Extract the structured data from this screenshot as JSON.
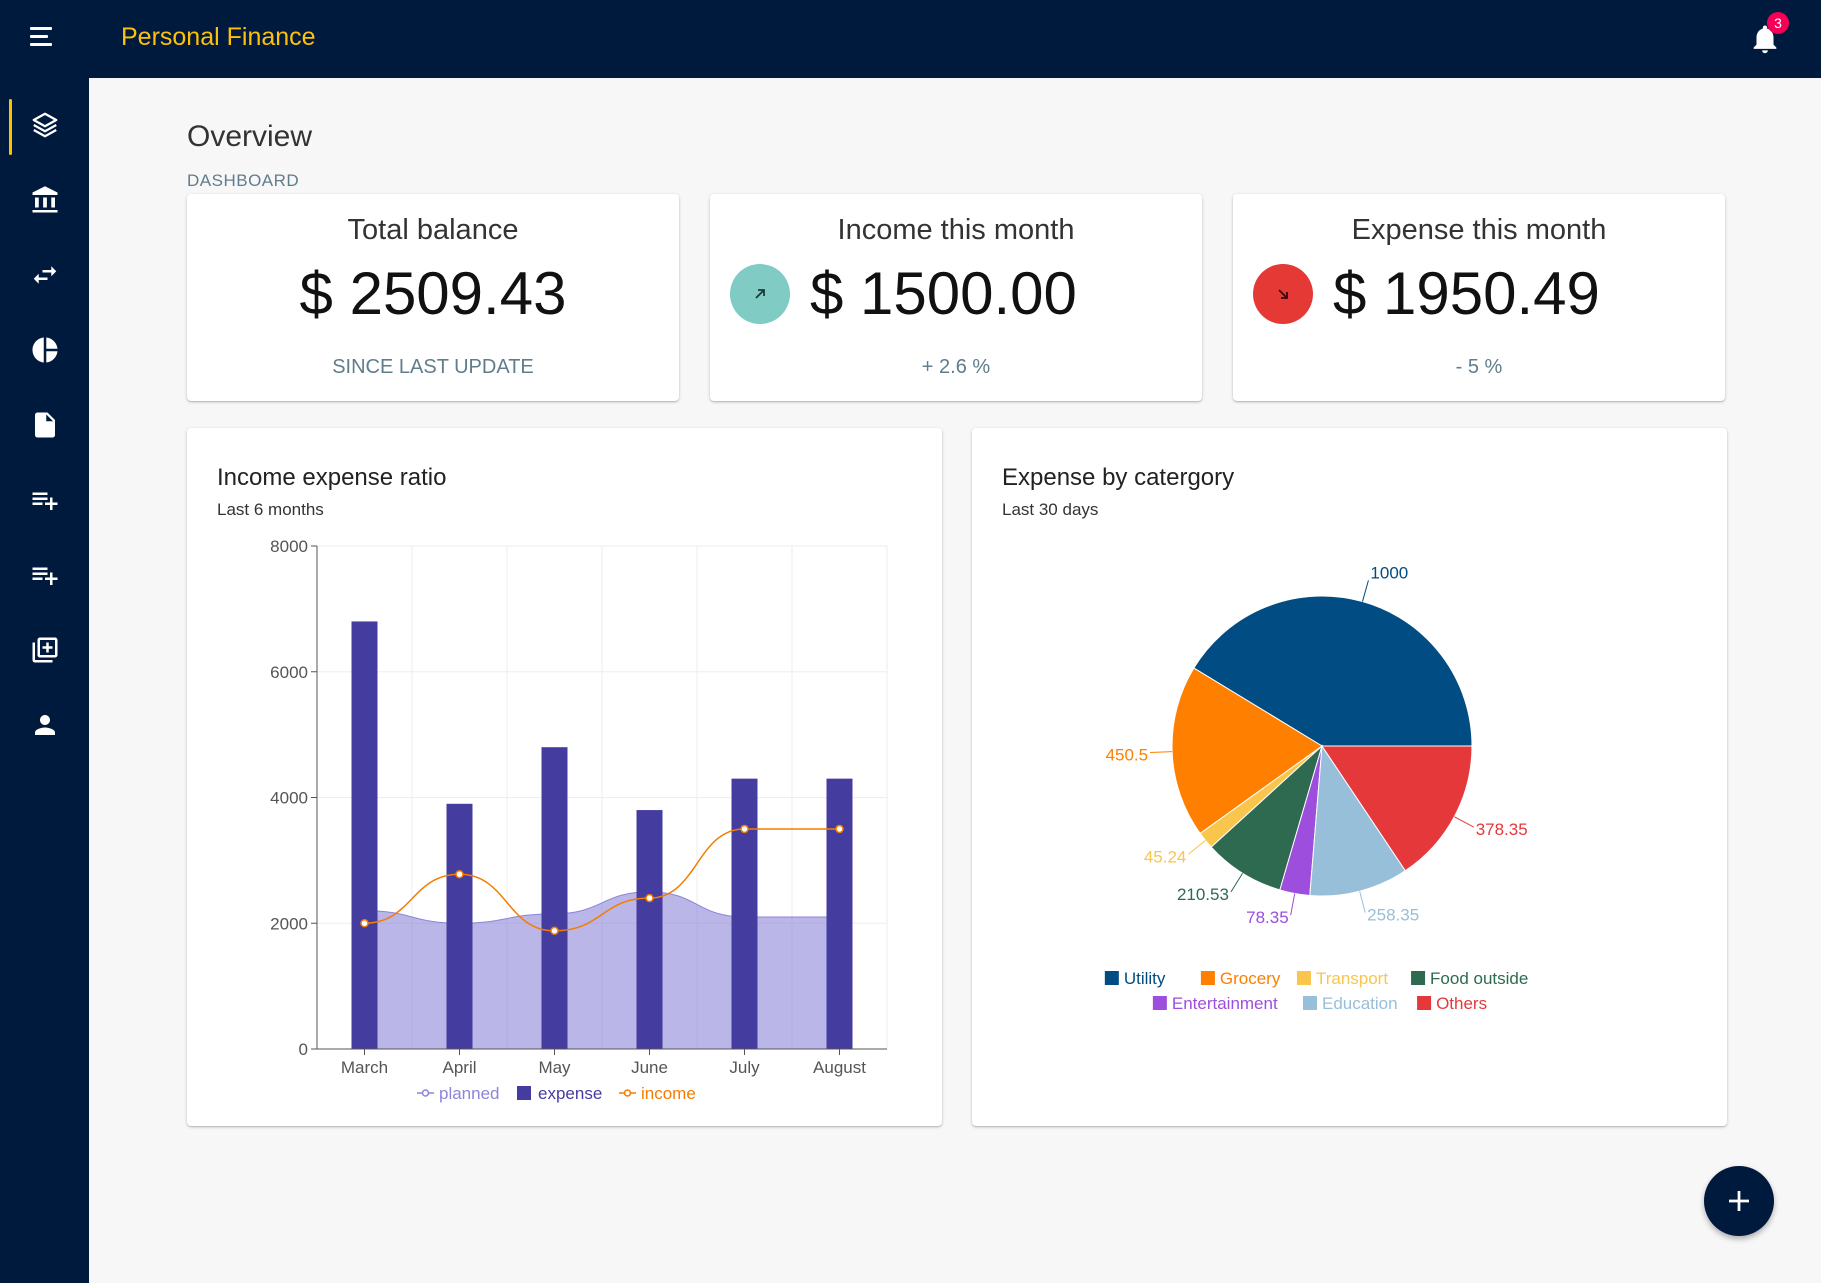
{
  "app": {
    "title": "Personal Finance",
    "notifications": "3"
  },
  "colors": {
    "nav_bg": "#001a3e",
    "accent": "#ffc107",
    "income": "#80cbc4",
    "expense": "#e53935"
  },
  "sidebar": {
    "items": [
      {
        "icon": "layers-icon",
        "active": true
      },
      {
        "icon": "bank-icon"
      },
      {
        "icon": "transfer-icon"
      },
      {
        "icon": "pie-chart-icon"
      },
      {
        "icon": "file-icon"
      },
      {
        "icon": "playlist-add-icon"
      },
      {
        "icon": "playlist-add-icon"
      },
      {
        "icon": "library-add-icon"
      },
      {
        "icon": "person-icon"
      }
    ]
  },
  "page": {
    "title": "Overview",
    "breadcrumb": "DASHBOARD"
  },
  "stats": [
    {
      "title": "Total balance",
      "value": "$ 2509.43",
      "sub": "SINCE LAST UPDATE"
    },
    {
      "title": "Income this month",
      "value": "$ 1500.00",
      "sub": "+ 2.6 %",
      "icon": "trending-up-icon"
    },
    {
      "title": "Expense this month",
      "value": "$ 1950.49",
      "sub": "- 5 %",
      "icon": "trending-down-icon"
    }
  ],
  "charts": {
    "ratio": {
      "title": "Income expense ratio",
      "subtitle": "Last 6 months"
    },
    "category": {
      "title": "Expense by catergory",
      "subtitle": "Last 30 days"
    }
  },
  "chart_data": [
    {
      "type": "bar",
      "title": "Income expense ratio",
      "subtitle": "Last 6 months",
      "categories": [
        "March",
        "April",
        "May",
        "June",
        "July",
        "August"
      ],
      "ylim": [
        0,
        8000
      ],
      "yticks": [
        "0",
        "2000",
        "4000",
        "6000",
        "8000"
      ],
      "grid": true,
      "legend": "bottom",
      "series": [
        {
          "name": "planned",
          "type": "area",
          "color": "#8c85d9",
          "values": [
            2200,
            2000,
            2150,
            2500,
            2100,
            2100
          ]
        },
        {
          "name": "expense",
          "type": "bar",
          "color": "#443c9e",
          "values": [
            6800,
            3900,
            4800,
            3800,
            4300,
            4300
          ]
        },
        {
          "name": "income",
          "type": "line",
          "color": "#f57c00",
          "values": [
            2000,
            2780,
            1880,
            2400,
            3500,
            3500
          ]
        }
      ]
    },
    {
      "type": "pie",
      "title": "Expense by catergory",
      "subtitle": "Last 30 days",
      "legend": "bottom",
      "slices": [
        {
          "name": "Utility",
          "value": 1000,
          "label": "1000",
          "color": "#004c83"
        },
        {
          "name": "Grocery",
          "value": 450.5,
          "label": "450.5",
          "color": "#ff7f00"
        },
        {
          "name": "Transport",
          "value": 45.24,
          "label": "45.24",
          "color": "#f9c54d"
        },
        {
          "name": "Food outside",
          "value": 210.53,
          "label": "210.53",
          "color": "#2d6a4f"
        },
        {
          "name": "Entertainment",
          "value": 78.35,
          "label": "78.35",
          "color": "#9d4edd"
        },
        {
          "name": "Education",
          "value": 258.35,
          "label": "258.35",
          "color": "#97bfd9"
        },
        {
          "name": "Others",
          "value": 378.35,
          "label": "378.35",
          "color": "#e5383b"
        }
      ]
    }
  ]
}
